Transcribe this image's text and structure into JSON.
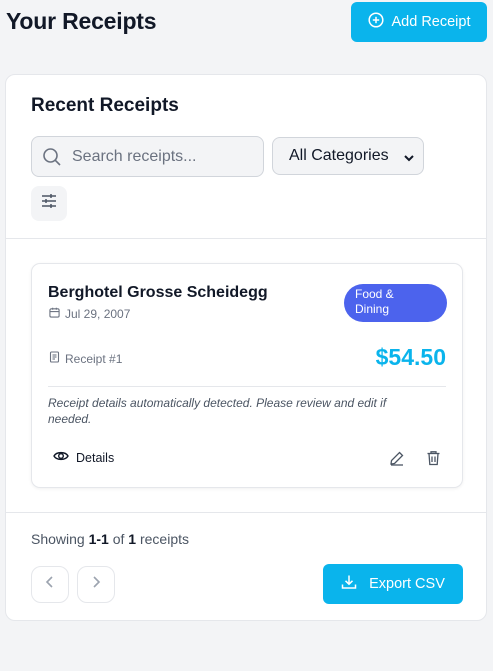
{
  "header": {
    "title": "Your Receipts",
    "add_button_label": "Add Receipt"
  },
  "panel": {
    "title": "Recent Receipts",
    "search_placeholder": "Search receipts...",
    "category_selected": "All Categories"
  },
  "receipts": [
    {
      "merchant": "Berghotel Grosse Scheidegg",
      "date": "Jul 29, 2007",
      "category_line1": "Food &",
      "category_line2": "Dining",
      "receipt_number": "Receipt #1",
      "amount": "$54.50",
      "note": "Receipt details automatically detected. Please review and edit if needed.",
      "details_label": "Details"
    }
  ],
  "pagination": {
    "showing_prefix": "Showing",
    "range": "1-1",
    "of_text": "of",
    "total": "1",
    "suffix": "receipts",
    "export_label": "Export CSV"
  },
  "colors": {
    "accent": "#0ab4ec",
    "badge": "#4c63ed"
  },
  "icons": [
    "plus-circle-icon",
    "search-icon",
    "chevron-down-icon",
    "sliders-icon",
    "calendar-icon",
    "receipt-icon",
    "eye-icon",
    "pencil-icon",
    "trash-icon",
    "chevron-left-icon",
    "chevron-right-icon",
    "download-icon"
  ]
}
